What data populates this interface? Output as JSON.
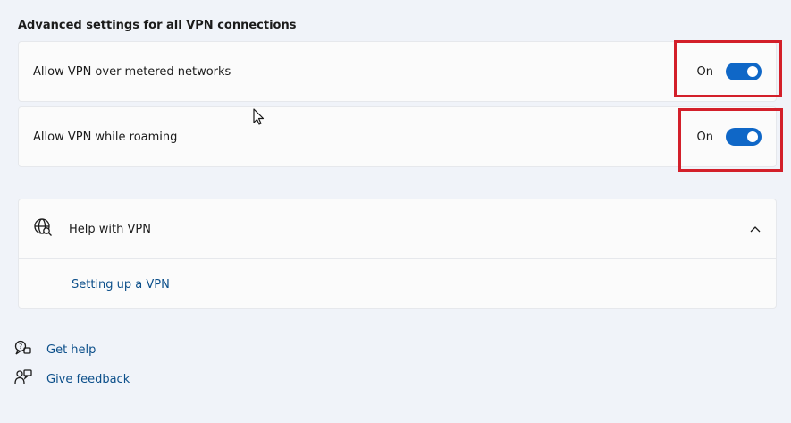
{
  "section": {
    "title": "Advanced settings for all VPN connections"
  },
  "settings": [
    {
      "label": "Allow VPN over metered networks",
      "state_text": "On",
      "on": true
    },
    {
      "label": "Allow VPN while roaming",
      "state_text": "On",
      "on": true
    }
  ],
  "help": {
    "title": "Help with VPN",
    "link": "Setting up a VPN"
  },
  "footer": {
    "get_help": "Get help",
    "give_feedback": "Give feedback"
  },
  "colors": {
    "toggle_on": "#0f67c7",
    "highlight": "#d31f2a",
    "link": "#0c4f8a"
  },
  "icons": {
    "help": "globe-search-icon",
    "chevron": "chevron-up-icon",
    "get_help": "help-chat-icon",
    "feedback": "feedback-icon"
  }
}
